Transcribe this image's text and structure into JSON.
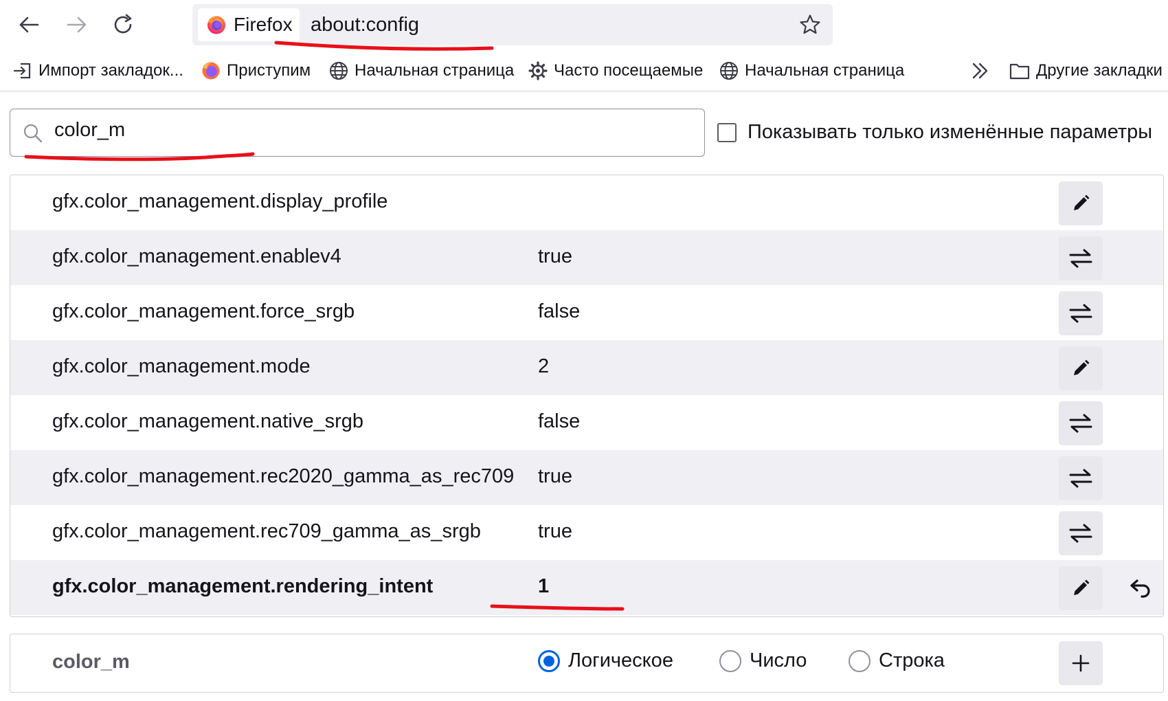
{
  "toolbar": {
    "identity_label": "Firefox",
    "url": "about:config"
  },
  "bookmarks": [
    {
      "label": "Импорт закладок...",
      "icon": "import-icon"
    },
    {
      "label": "Приступим",
      "icon": "firefox-icon"
    },
    {
      "label": "Начальная страница",
      "icon": "globe-icon"
    },
    {
      "label": "Часто посещаемые",
      "icon": "gear-icon"
    },
    {
      "label": "Начальная страница",
      "icon": "globe-icon"
    }
  ],
  "bookmarks_other": "Другие закладки",
  "search": {
    "value": "color_m",
    "modified_only_label": "Показывать только изменённые параметры"
  },
  "prefs": [
    {
      "name": "gfx.color_management.display_profile",
      "value": "",
      "action": "edit",
      "modified": false
    },
    {
      "name": "gfx.color_management.enablev4",
      "value": "true",
      "action": "toggle",
      "modified": false
    },
    {
      "name": "gfx.color_management.force_srgb",
      "value": "false",
      "action": "toggle",
      "modified": false
    },
    {
      "name": "gfx.color_management.mode",
      "value": "2",
      "action": "edit",
      "modified": false
    },
    {
      "name": "gfx.color_management.native_srgb",
      "value": "false",
      "action": "toggle",
      "modified": false
    },
    {
      "name": "gfx.color_management.rec2020_gamma_as_rec709",
      "value": "true",
      "action": "toggle",
      "modified": false
    },
    {
      "name": "gfx.color_management.rec709_gamma_as_srgb",
      "value": "true",
      "action": "toggle",
      "modified": false
    },
    {
      "name": "gfx.color_management.rendering_intent",
      "value": "1",
      "action": "edit",
      "modified": true
    }
  ],
  "new_pref": {
    "name": "color_m",
    "types": [
      {
        "label": "Логическое",
        "checked": true
      },
      {
        "label": "Число",
        "checked": false
      },
      {
        "label": "Строка",
        "checked": false
      }
    ]
  },
  "colors": {
    "annotation": "#e8101a",
    "accent": "#0061e0"
  }
}
